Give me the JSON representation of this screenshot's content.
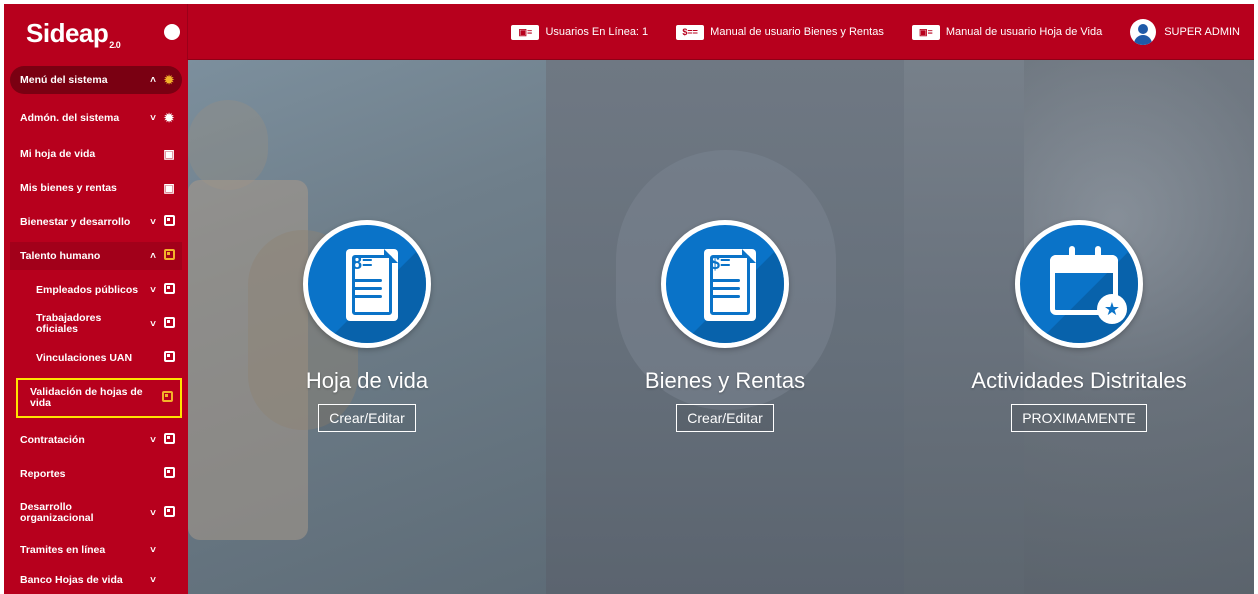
{
  "app": {
    "logo_text": "Sideap",
    "logo_suffix": "2.0"
  },
  "topbar": {
    "users_online_label": "Usuarios En Línea: 1",
    "manual_bienes_label": "Manual de usuario Bienes y Rentas",
    "manual_hoja_label": "Manual de usuario Hoja de Vida",
    "user_label": "SUPER ADMIN"
  },
  "sidebar": {
    "items": [
      {
        "label": "Menú del sistema"
      },
      {
        "label": "Admón. del sistema"
      },
      {
        "label": "Mi hoja de vida"
      },
      {
        "label": "Mis bienes y rentas"
      },
      {
        "label": "Bienestar y desarrollo"
      },
      {
        "label": "Talento humano"
      },
      {
        "label": "Empleados públicos"
      },
      {
        "label": "Trabajadores oficiales"
      },
      {
        "label": "Vinculaciones UAN"
      },
      {
        "label": "Validación de hojas de vida"
      },
      {
        "label": "Contratación"
      },
      {
        "label": "Reportes"
      },
      {
        "label": "Desarrollo organizacional"
      },
      {
        "label": "Tramites en línea"
      },
      {
        "label": "Banco Hojas de vida"
      }
    ]
  },
  "cards": [
    {
      "title": "Hoja de vida",
      "button": "Crear/Editar",
      "icon": "cv-document-icon"
    },
    {
      "title": "Bienes y Rentas",
      "button": "Crear/Editar",
      "icon": "money-document-icon"
    },
    {
      "title": "Actividades Distritales",
      "button": "PROXIMAMENTE",
      "icon": "calendar-star-icon"
    }
  ],
  "colors": {
    "primary_red": "#b7001d",
    "accent_gold": "#f3b32a",
    "highlight_yellow": "#ffe200",
    "icon_blue": "#0a73c8"
  }
}
